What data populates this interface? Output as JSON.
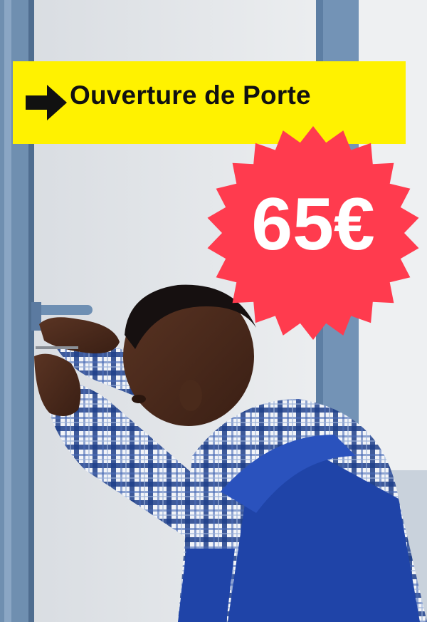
{
  "banner": {
    "title": "Ouverture de Porte",
    "arrow_icon": "right-arrow-icon",
    "background_color": "#fff200"
  },
  "price": {
    "amount": "65€",
    "badge_color": "#ff3b4e",
    "badge_icon": "starburst-badge"
  },
  "photo": {
    "subject": "locksmith-photo"
  }
}
